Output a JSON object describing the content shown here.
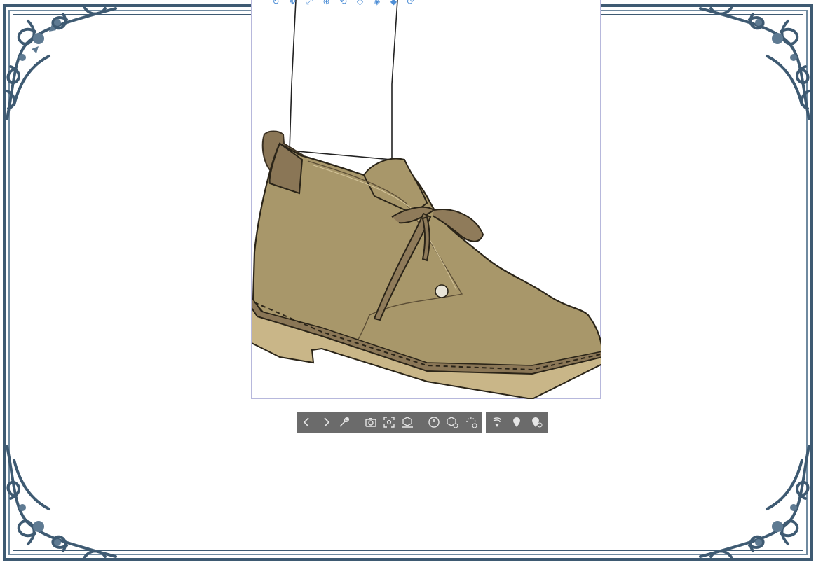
{
  "app": {
    "mode": "3d-model-editing"
  },
  "colors": {
    "frame": "#3e5a72",
    "canvas_border": "#b7b8dc",
    "boot_main": "#a8976a",
    "boot_dark": "#8a7656",
    "sole": "#c9b688",
    "lace": "#8f7b5a",
    "toolbar_bg": "#6b6b6b",
    "toolbar_icon": "#e6e6e6",
    "top_toolbar_icon": "#4f8fd6"
  },
  "top_toolbar": {
    "icons": [
      "camera-rotate-icon",
      "pan-icon",
      "move-icon",
      "xy-plane-move-icon",
      "rotate-object-icon",
      "scale-object-icon",
      "reset-object-icon",
      "layer-object-icon",
      "undo-rotate-icon"
    ]
  },
  "control_bar": {
    "group1": [
      "previous-icon",
      "next-icon",
      "wrench-icon",
      "camera-icon",
      "fit-view-icon",
      "ground-icon",
      "reset-angle-icon",
      "object-rotate-icon",
      "reset-rotate-icon"
    ],
    "group2": [
      "light-source-icon",
      "light-icon",
      "light-settings-icon"
    ]
  },
  "canvas": {
    "content": "boot-3d-model"
  }
}
